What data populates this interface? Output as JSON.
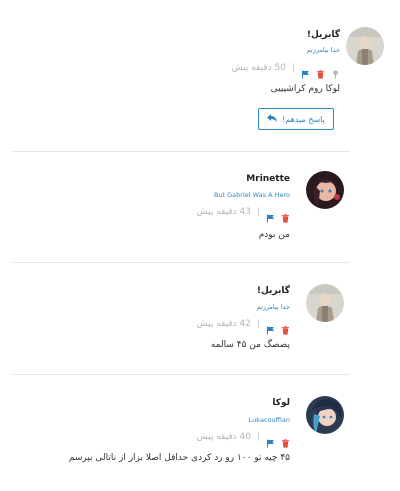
{
  "comments": [
    {
      "author": "گابریل!",
      "subtitle": "خدا بیامرزتم",
      "time": "50 دقیقه پیش",
      "text": "لوکا روم کراشیییی",
      "reply_label": "پاسخ میدهم!"
    },
    {
      "author": "Mrinette",
      "subtitle": "But Gabriel Was A Hero",
      "time": "43 دقیقه پیش",
      "text": "من بودم"
    },
    {
      "author": "گابریل!",
      "subtitle": "خدا بیامرزتم",
      "time": "42 دقیقه پیش",
      "text": "پصصگ من ۴۵ سالمه"
    },
    {
      "author": "لوکا",
      "subtitle": "Lukacouffian",
      "time": "40 دقیقه پیش",
      "text": "۴۵ چیه تو ۱۰۰ رو رد کردی حداقل اصلا بزار از ناتالی بپرسم"
    }
  ],
  "colors": {
    "accent": "#2e86c1",
    "delete": "#e74c3c",
    "muted": "#b5b5b5"
  },
  "icons": [
    "pin-icon",
    "trash-icon",
    "flag-icon",
    "reply-icon"
  ]
}
